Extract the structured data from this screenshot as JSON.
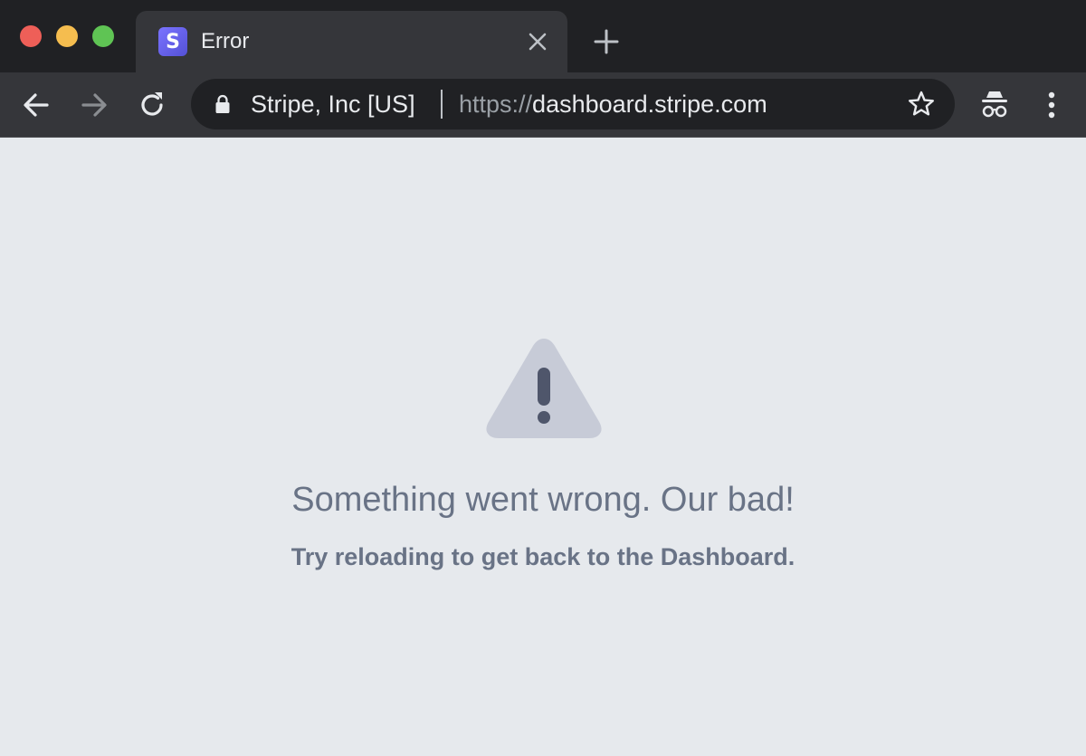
{
  "window": {
    "traffic_lights": [
      "close",
      "minimize",
      "zoom"
    ]
  },
  "tab": {
    "favicon_letter": "S",
    "title": "Error"
  },
  "toolbar": {
    "site_identity": "Stripe, Inc [US]",
    "url_scheme": "https://",
    "url_host": "dashboard.stripe.com"
  },
  "error": {
    "headline": "Something went wrong. Our bad!",
    "message": "Try reloading to get back to the Dashboard."
  },
  "colors": {
    "tabstrip": "#202124",
    "toolbar": "#35363a",
    "page_background": "#e6e9ed",
    "text": "#697386",
    "warning_triangle": "#c7cbd7",
    "warning_mark": "#4f566b",
    "brand": "#635bff"
  },
  "icons": {
    "tab_favicon": "stripe-logo-icon",
    "tab_close": "close-icon",
    "new_tab": "plus-icon",
    "back": "arrow-left-icon",
    "forward": "arrow-right-icon",
    "reload": "reload-icon",
    "secure": "lock-icon",
    "bookmark": "star-icon",
    "profile": "incognito-icon",
    "menu": "more-vertical-icon",
    "error": "warning-triangle-icon"
  }
}
